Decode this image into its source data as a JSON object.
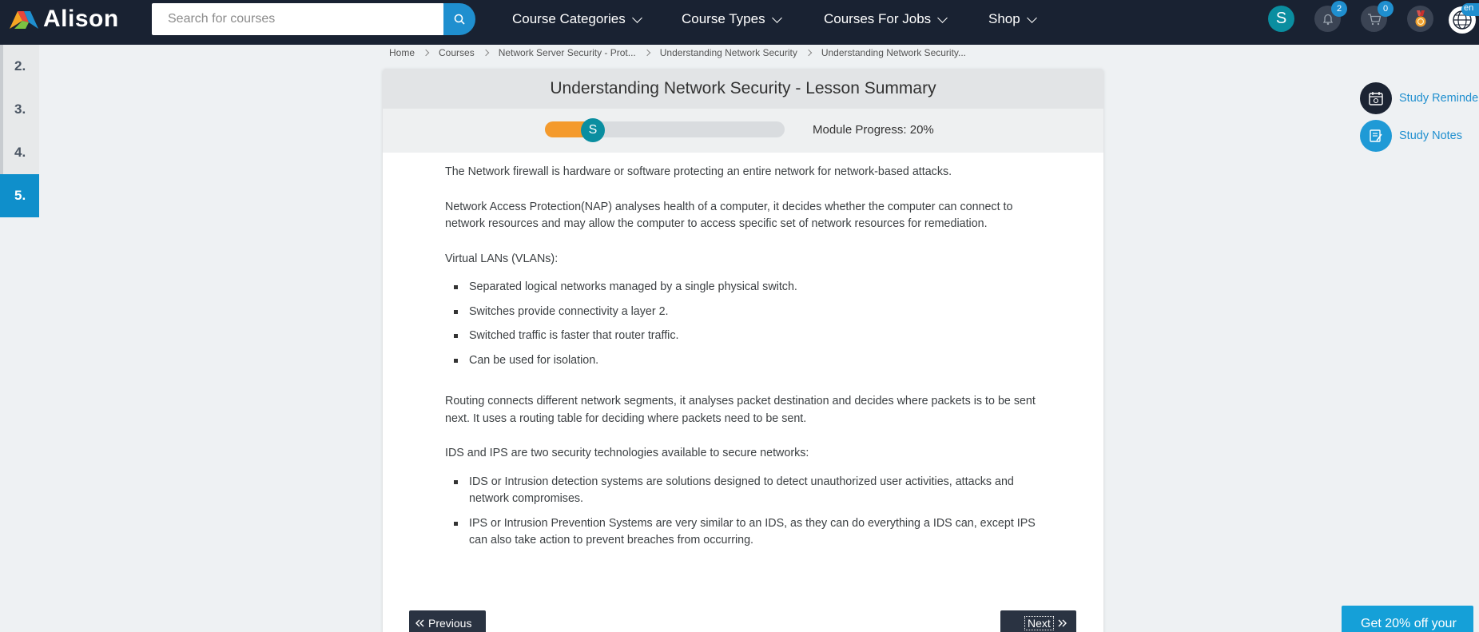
{
  "brand": {
    "name": "Alison"
  },
  "search": {
    "placeholder": "Search for courses"
  },
  "nav": {
    "course_categories": "Course Categories",
    "course_types": "Course Types",
    "courses_for_jobs": "Courses For Jobs",
    "shop": "Shop"
  },
  "user": {
    "avatar_initial": "S",
    "notifications_count": "2",
    "cart_count": "0",
    "language": "en"
  },
  "lessons": [
    {
      "label": "2.",
      "active": false
    },
    {
      "label": "3.",
      "active": false
    },
    {
      "label": "4.",
      "active": false
    },
    {
      "label": "5.",
      "active": true
    }
  ],
  "breadcrumb": [
    "Home",
    "Courses",
    "Network Server Security - Prot...",
    "Understanding Network Security",
    "Understanding Network Security..."
  ],
  "lesson": {
    "title": "Understanding Network Security - Lesson Summary",
    "progress_knob": "S",
    "progress_percent": 20,
    "progress_label": "Module Progress: 20%",
    "para1": "The Network firewall is hardware or software protecting an entire network for network-based attacks.",
    "para2": "Network Access Protection(NAP) analyses health of a computer, it decides whether the computer can connect to network resources and may allow the computer to access specific set of network resources for remediation.",
    "vlan_heading": "Virtual LANs (VLANs):",
    "vlan_items": [
      "Separated logical networks managed by a single physical switch.",
      "Switches provide connectivity a layer 2.",
      "Switched traffic is faster that router traffic.",
      "Can be used for isolation."
    ],
    "para3": "Routing connects different network segments, it analyses packet destination and decides where packets is to be sent next. It uses a routing table for deciding where packets need to be sent.",
    "ids_heading": "IDS and IPS are two security technologies available to secure networks:",
    "ids_items": [
      "IDS or Intrusion detection systems are solutions designed to detect unauthorized user activities, attacks and network compromises.",
      "IPS or Intrusion Prevention Systems are very similar to an IDS, as they can do everything a IDS can, except IPS can also take action to prevent breaches from occurring."
    ]
  },
  "buttons": {
    "previous": "Previous",
    "next": "Next"
  },
  "tools": {
    "study_reminders": "Study Reminders",
    "study_notes": "Study Notes"
  },
  "promo": {
    "text": "Get 20% off your"
  },
  "colors": {
    "topbar": "#192232",
    "accent_blue": "#1f8fcf",
    "teal": "#0a8ea0",
    "progress_orange": "#f49a2c"
  }
}
